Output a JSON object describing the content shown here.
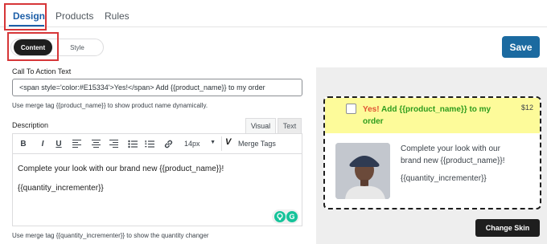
{
  "tabs": {
    "design": "Design",
    "products": "Products",
    "rules": "Rules"
  },
  "mode": {
    "content": "Content",
    "style": "Style"
  },
  "save_label": "Save",
  "cta": {
    "label": "Call To Action Text",
    "value": "<span style='color:#E15334'>Yes!</span> Add {{product_name}} to my order",
    "help": "Use merge tag {{product_name}} to show product name dynamically."
  },
  "description": {
    "label": "Description",
    "tab_visual": "Visual",
    "tab_text": "Text",
    "toolbar": {
      "bold": "B",
      "italic": "I",
      "underline": "U",
      "font_size": "14px",
      "merge_tags": "Merge Tags"
    },
    "line1": "Complete your look with our brand new {{product_name}}!",
    "line2": "{{quantity_incrementer}}",
    "help": "Use merge tag {{quantity_incrementer}} to show the quantity changer"
  },
  "preview": {
    "title_yes": "Yes!",
    "title_rest": " Add {{product_name}} to my order",
    "price": "$12",
    "desc_line1": "Complete your look with our",
    "desc_line2": "brand new {{product_name}}!",
    "desc_line3": "{{quantity_incrementer}}",
    "change_skin": "Change Skin"
  },
  "colors": {
    "accent": "#1b6aa0",
    "highlight": "#d63638",
    "yes": "#e15334",
    "title_green": "#2e9c1d",
    "preview_header": "#fdfb9a"
  }
}
